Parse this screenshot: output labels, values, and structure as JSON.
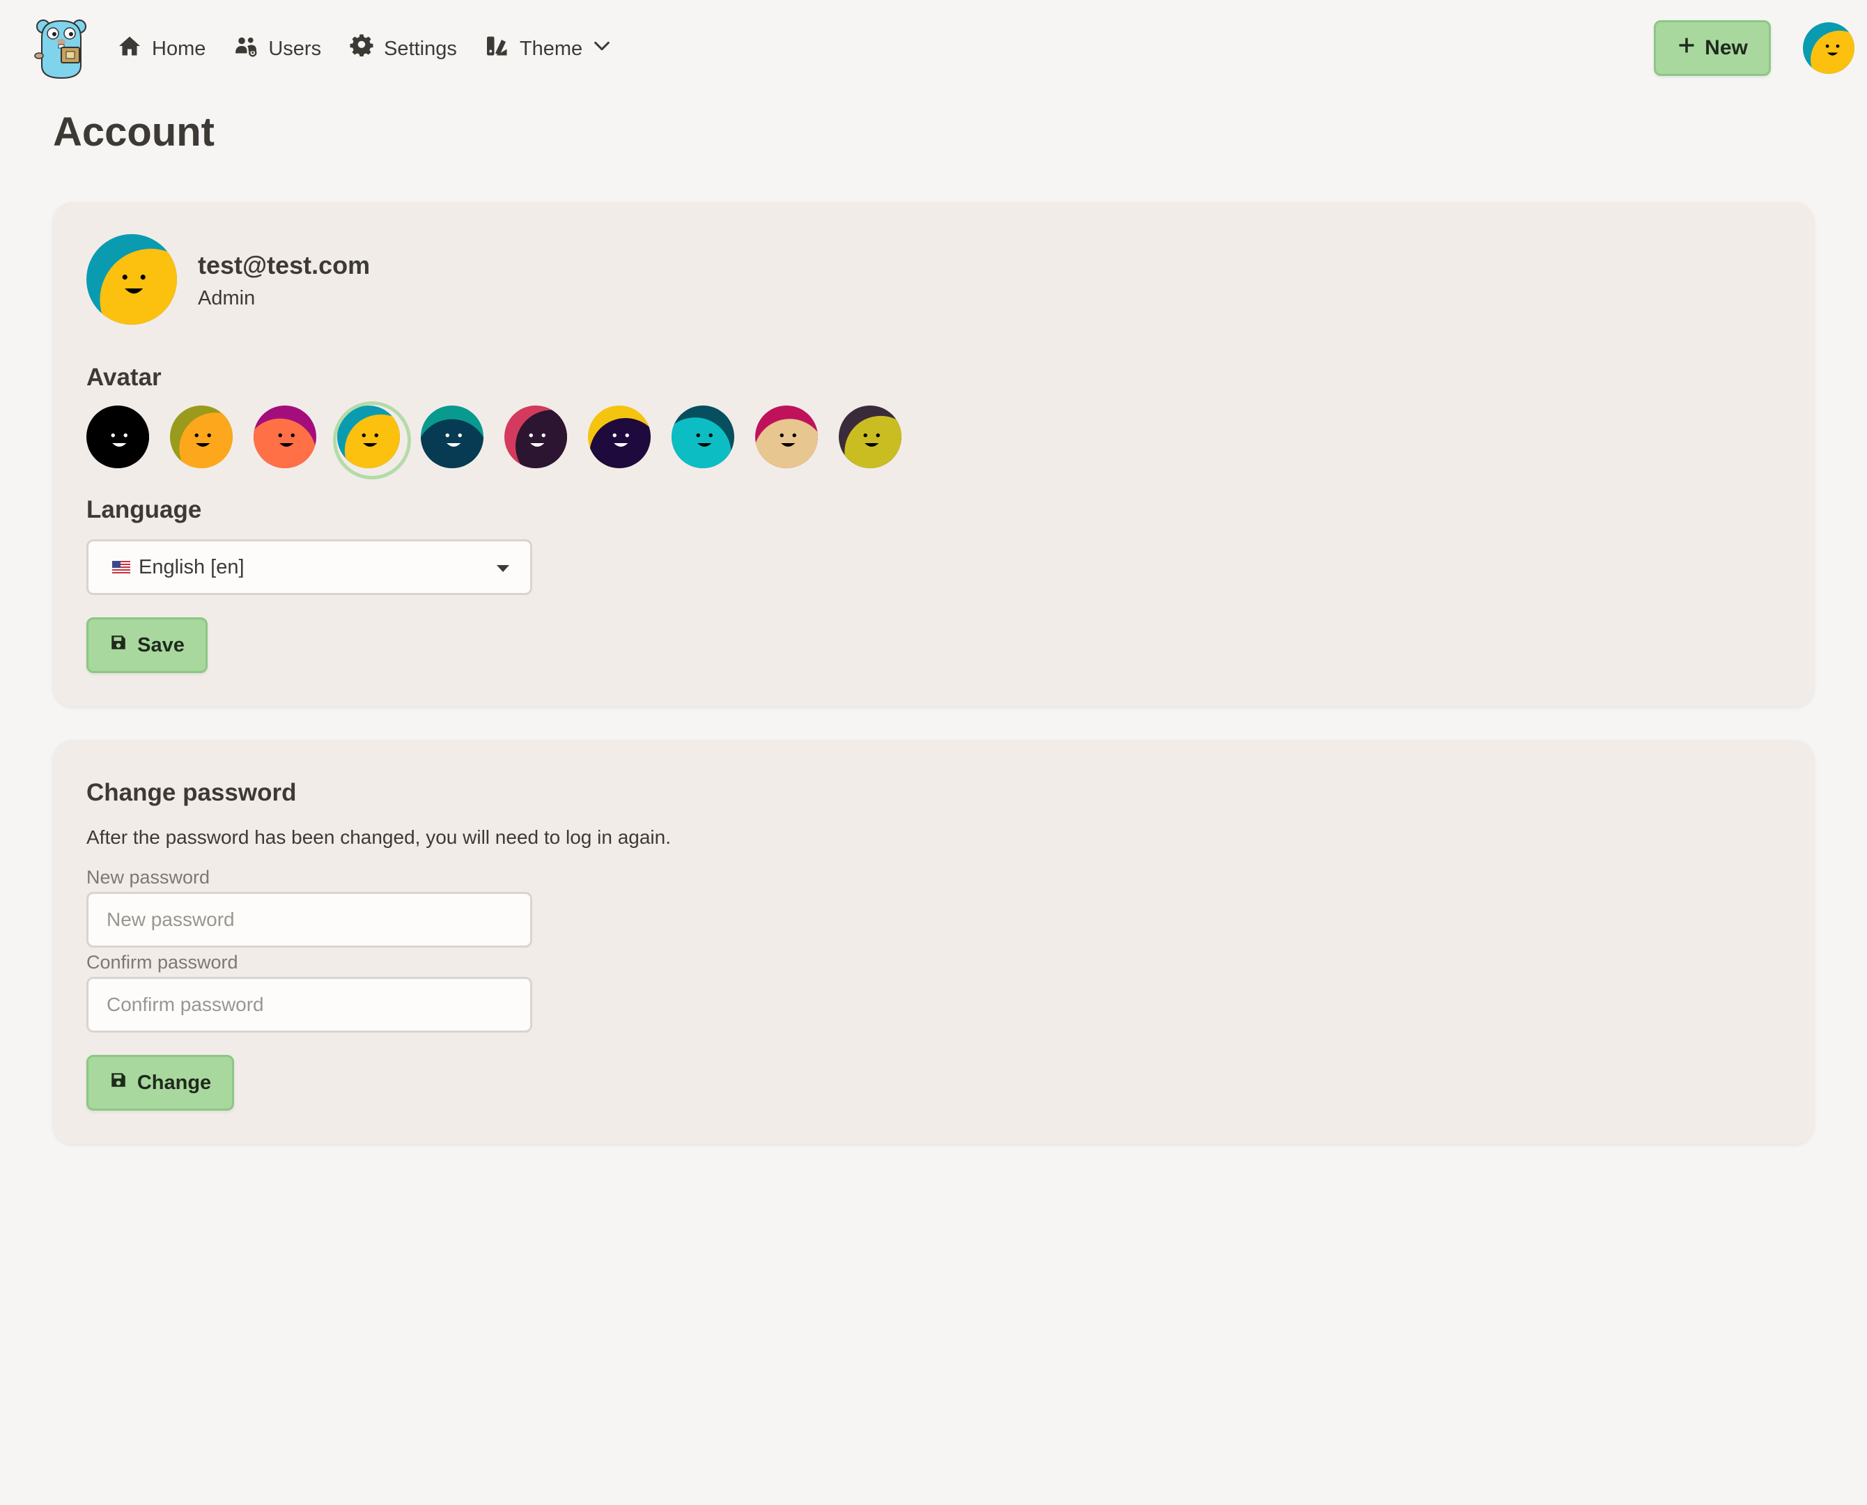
{
  "nav": {
    "links": [
      {
        "label": "Home",
        "icon": "home-icon"
      },
      {
        "label": "Users",
        "icon": "users-icon"
      },
      {
        "label": "Settings",
        "icon": "gear-icon"
      },
      {
        "label": "Theme",
        "icon": "theme-icon"
      }
    ],
    "new_label": "New",
    "logo_icon": "gopher-logo-icon"
  },
  "page": {
    "title": "Account"
  },
  "profile": {
    "email": "test@test.com",
    "role": "Admin"
  },
  "avatar_section": {
    "label": "Avatar",
    "selected_index": 3,
    "options": [
      {
        "bg": "#000000",
        "face": "#000000",
        "eyes": "#ffffff"
      },
      {
        "bg": "#9a9a1c",
        "face": "#fda71c",
        "eyes": "#000000"
      },
      {
        "bg": "#a30e7c",
        "face": "#ff7047",
        "eyes": "#000000"
      },
      {
        "bg": "#0a9bb0",
        "face": "#fcc00f",
        "eyes": "#000000"
      },
      {
        "bg": "#089a8f",
        "face": "#073a53",
        "eyes": "#ffffff"
      },
      {
        "bg": "#d33a5d",
        "face": "#2b1530",
        "eyes": "#ffffff"
      },
      {
        "bg": "#f4c40f",
        "face": "#1e0a3d",
        "eyes": "#ffffff"
      },
      {
        "bg": "#064f5e",
        "face": "#0cbdc4",
        "eyes": "#000000"
      },
      {
        "bg": "#c0125b",
        "face": "#e7c690",
        "eyes": "#000000"
      },
      {
        "bg": "#3a2b3a",
        "face": "#c9bd22",
        "eyes": "#000000"
      }
    ]
  },
  "language": {
    "label": "Language",
    "value": "English [en]",
    "flag_icon": "us-flag-icon"
  },
  "save_label": "Save",
  "change_password": {
    "title": "Change password",
    "description": "After the password has been changed, you will need to log in again.",
    "new_label": "New password",
    "new_placeholder": "New password",
    "confirm_label": "Confirm password",
    "confirm_placeholder": "Confirm password",
    "button_label": "Change"
  },
  "colors": {
    "accent_green": "#a8d89d",
    "card_bg": "#f2ece8",
    "page_bg": "#f6f5f3"
  }
}
